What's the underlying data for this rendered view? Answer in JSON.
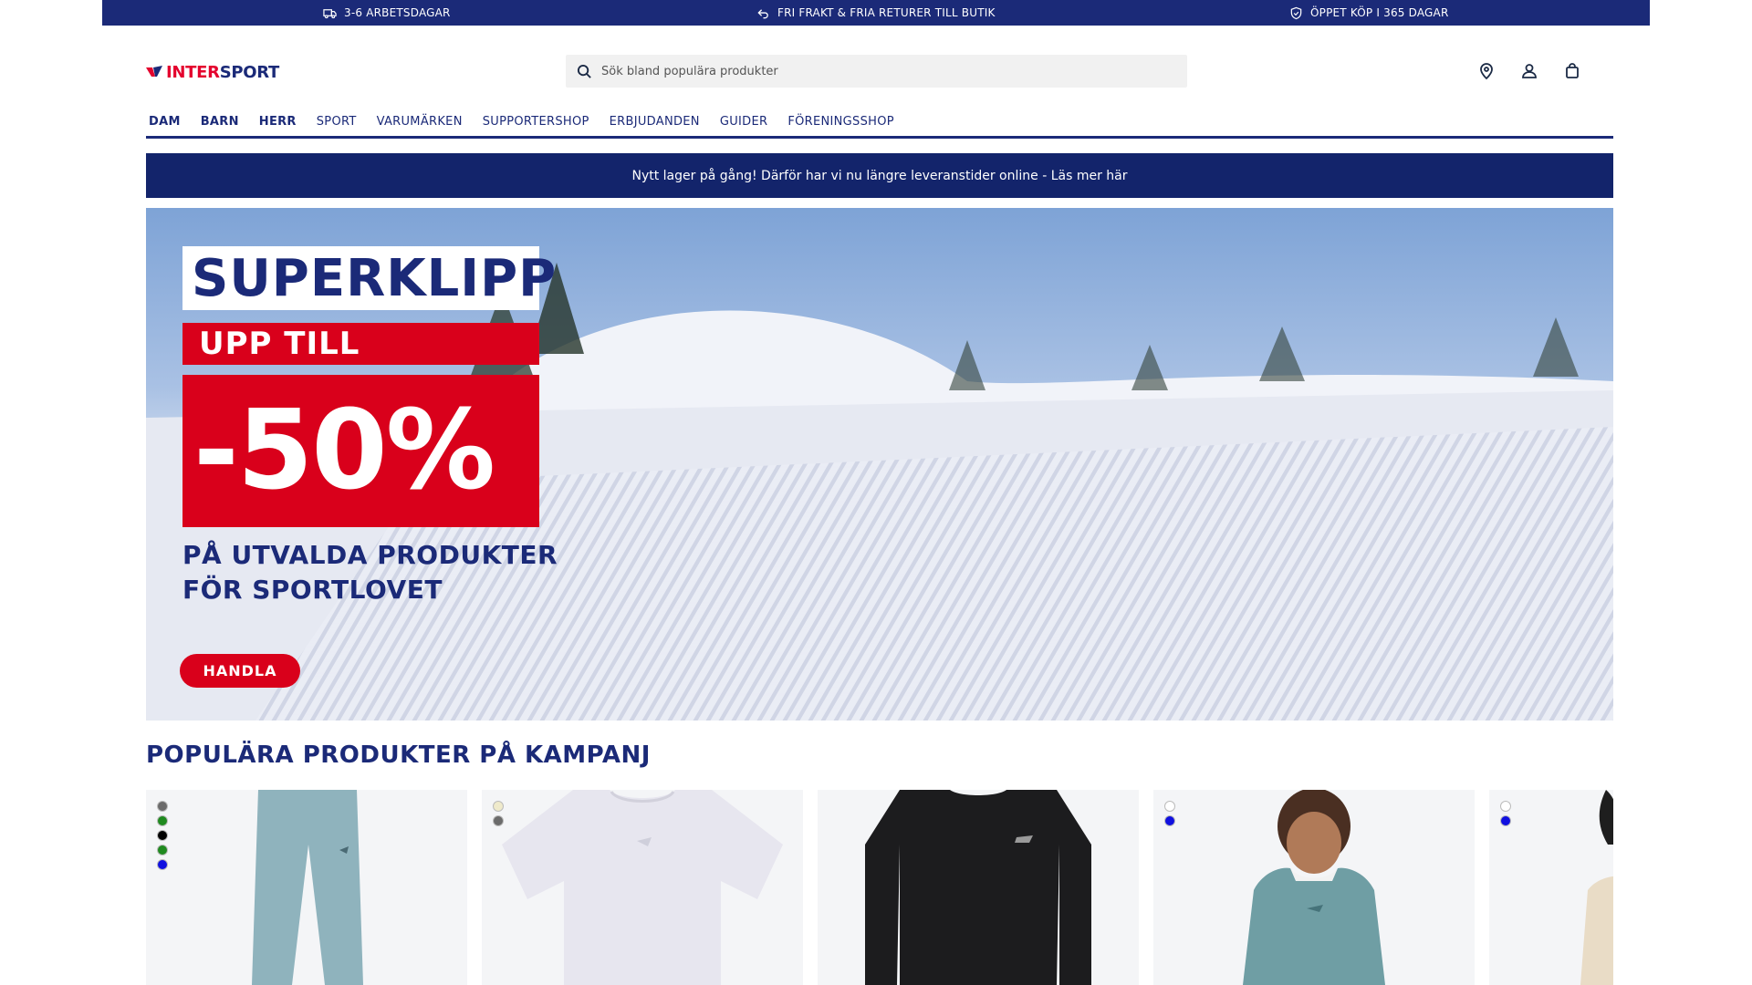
{
  "usp": [
    {
      "icon": "truck-icon",
      "text": "3-6 ARBETSDAGAR"
    },
    {
      "icon": "return-arrow-icon",
      "text": "FRI FRAKT & FRIA RETURER TILL BUTIK"
    },
    {
      "icon": "shield-icon",
      "text": "ÖPPET KÖP I 365 DAGAR"
    }
  ],
  "header": {
    "logo": {
      "primary": "INTER",
      "accent": "SPORT"
    },
    "search_placeholder": "Sök bland populära produkter"
  },
  "nav": [
    "DAM",
    "BARN",
    "HERR",
    "SPORT",
    "VARUMÄRKEN",
    "SUPPORTERSHOP",
    "ERBJUDANDEN",
    "GUIDER",
    "FÖRENINGSSHOP"
  ],
  "announcement": "Nytt lager på gång! Därför har vi nu längre leveranstider online - Läs mer här",
  "hero": {
    "title": "SUPERKLIPP",
    "upto": "UPP TILL",
    "discount": "-50%",
    "subtitle_line1": "PÅ UTVALDA PRODUKTER",
    "subtitle_line2": "FÖR SPORTLOVET",
    "cta": "HANDLA"
  },
  "section": {
    "title": "POPULÄRA PRODUKTER PÅ KAMPANJ"
  },
  "products": [
    {
      "swatches": [
        "#6b6b6b",
        "#1f8a1f",
        "#000000",
        "#1f8a1f",
        "#1010e0"
      ]
    },
    {
      "swatches": [
        "#efeacb",
        "#6b6b6b"
      ]
    },
    {
      "swatches": []
    },
    {
      "swatches": [
        "#ffffff",
        "#1010e0"
      ]
    },
    {
      "swatches": [
        "#ffffff",
        "#1010e0"
      ]
    }
  ],
  "colors": {
    "brand_navy": "#1b2a78",
    "brand_red": "#d9001b",
    "announce_bg": "#13246b"
  }
}
